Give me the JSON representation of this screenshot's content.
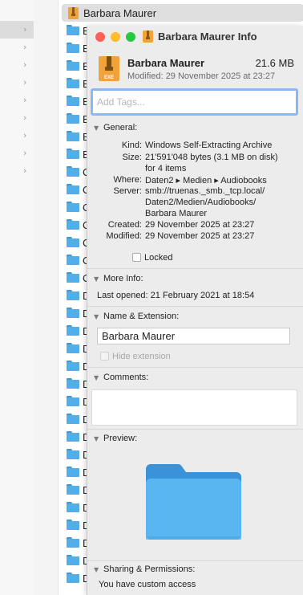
{
  "finder": {
    "selected_item": "Barbara Maurer",
    "list_letters": [
      "B",
      "B",
      "B",
      "B",
      "B",
      "B",
      "B",
      "B",
      "C",
      "C",
      "C",
      "C",
      "C",
      "C",
      "C",
      "D",
      "D",
      "D",
      "D",
      "D",
      "D",
      "D",
      "D",
      "D",
      "D",
      "D",
      "D",
      "D",
      "D",
      "D",
      "D",
      "D"
    ]
  },
  "sidebar": {
    "chevron": "›"
  },
  "info": {
    "title": "Barbara Maurer Info",
    "name": "Barbara Maurer",
    "size": "21.6 MB",
    "modified_summary": "Modified: 29 November 2025 at 23:27",
    "tags_placeholder": "Add Tags...",
    "general": {
      "header": "General:",
      "kind_label": "Kind:",
      "kind_value": "Windows Self-Extracting Archive",
      "size_label": "Size:",
      "size_value_1": "21'591'048 bytes (3.1 MB on disk)",
      "size_value_2": "for 4 items",
      "where_label": "Where:",
      "where_value": "Daten2 ▸ Medien ▸ Audiobooks",
      "server_label": "Server:",
      "server_value_1": "smb://truenas._smb._tcp.local/",
      "server_value_2": "Daten2/Medien/Audiobooks/",
      "server_value_3": "Barbara Maurer",
      "created_label": "Created:",
      "created_value": "29 November 2025 at 23:27",
      "modified_label": "Modified:",
      "modified_value": "29 November 2025 at 23:27",
      "locked_label": "Locked"
    },
    "more_info": {
      "header": "More Info:",
      "last_opened": "Last opened: 21 February 2021 at 18:54"
    },
    "name_ext": {
      "header": "Name & Extension:",
      "value": "Barbara Maurer",
      "hide_extension": "Hide extension"
    },
    "comments": {
      "header": "Comments:"
    },
    "preview": {
      "header": "Preview:"
    },
    "sharing": {
      "header": "Sharing & Permissions:",
      "access": "You have custom access"
    },
    "icon_badge": "EXE"
  },
  "colors": {
    "folder_blue": "#52aee9",
    "archive_orange": "#f0a33a",
    "close_red": "#fe5f57",
    "minimize_yellow": "#febc2e",
    "zoom_green": "#28c840",
    "tag_focus": "#8cb8f0"
  }
}
